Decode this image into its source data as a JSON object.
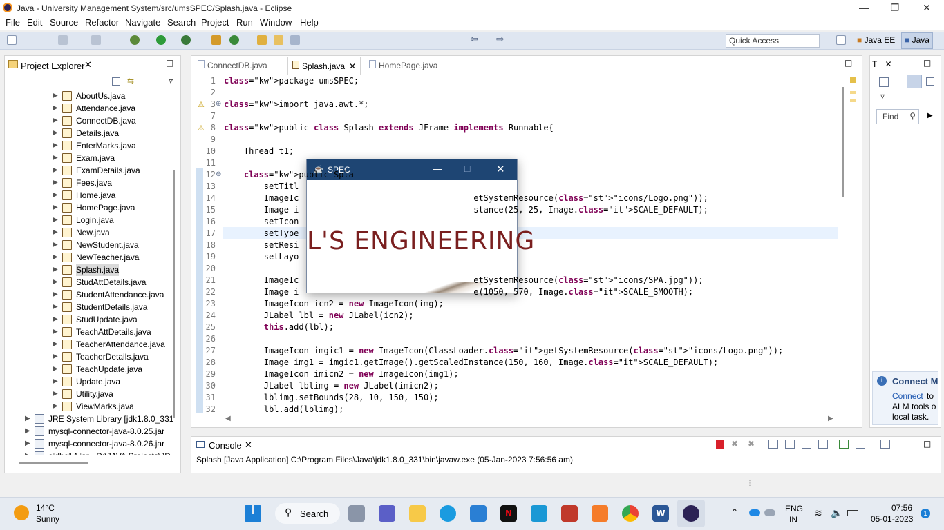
{
  "window": {
    "title": "Java - University Management System/src/umsSPEC/Splash.java - Eclipse"
  },
  "menu": [
    "File",
    "Edit",
    "Source",
    "Refactor",
    "Navigate",
    "Search",
    "Project",
    "Run",
    "Window",
    "Help"
  ],
  "toolbar": {
    "quick_access": "Quick Access",
    "persp_javaee": "Java EE",
    "persp_java": "Java"
  },
  "project_explorer": {
    "title": "Project Explorer",
    "files": [
      "AboutUs.java",
      "Attendance.java",
      "ConnectDB.java",
      "Details.java",
      "EnterMarks.java",
      "Exam.java",
      "ExamDetails.java",
      "Fees.java",
      "Home.java",
      "HomePage.java",
      "Login.java",
      "New.java",
      "NewStudent.java",
      "NewTeacher.java",
      "Splash.java",
      "StudAttDetails.java",
      "StudentAttendance.java",
      "StudentDetails.java",
      "StudUpdate.java",
      "TeachAttDetails.java",
      "TeacherAttendance.java",
      "TeacherDetails.java",
      "TeachUpdate.java",
      "Update.java",
      "Utility.java",
      "ViewMarks.java"
    ],
    "selected": "Splash.java",
    "libs": [
      "JRE System Library [jdk1.8.0_331]",
      "mysql-connector-java-8.0.25.jar",
      "mysql-connector-java-8.0.26.jar",
      "ojdbc14.jar - D:\\JAVA Projects\\JD"
    ]
  },
  "editor": {
    "tabs": [
      "ConnectDB.java",
      "Splash.java",
      "HomePage.java"
    ],
    "active_tab": "Splash.java",
    "lines": [
      {
        "n": "1",
        "t": "package umsSPEC;"
      },
      {
        "n": "2",
        "t": ""
      },
      {
        "n": "3",
        "t": "import java.awt.*;"
      },
      {
        "n": "7",
        "t": ""
      },
      {
        "n": "8",
        "t": "public class Splash extends JFrame implements Runnable{"
      },
      {
        "n": "9",
        "t": ""
      },
      {
        "n": "10",
        "t": "    Thread t1;"
      },
      {
        "n": "11",
        "t": ""
      },
      {
        "n": "12",
        "t": "    public Spla"
      },
      {
        "n": "13",
        "t": "        setTitl"
      },
      {
        "n": "14",
        "t": "        ImageIc                                   etSystemResource(\"icons/Logo.png\"));"
      },
      {
        "n": "15",
        "t": "        Image i                                   stance(25, 25, Image.SCALE_DEFAULT);"
      },
      {
        "n": "16",
        "t": "        setIcon"
      },
      {
        "n": "17",
        "t": "        setType"
      },
      {
        "n": "18",
        "t": "        setResi"
      },
      {
        "n": "19",
        "t": "        setLayo"
      },
      {
        "n": "20",
        "t": ""
      },
      {
        "n": "21",
        "t": "        ImageIc                                   etSystemResource(\"icons/SPA.jpg\"));"
      },
      {
        "n": "22",
        "t": "        Image i                                   e(1050, 570, Image.SCALE_SMOOTH);"
      },
      {
        "n": "23",
        "t": "        ImageIcon icn2 = new ImageIcon(img);"
      },
      {
        "n": "24",
        "t": "        JLabel lbl = new JLabel(icn2);"
      },
      {
        "n": "25",
        "t": "        this.add(lbl);"
      },
      {
        "n": "26",
        "t": ""
      },
      {
        "n": "27",
        "t": "        ImageIcon imgic1 = new ImageIcon(ClassLoader.getSystemResource(\"icons/Logo.png\"));"
      },
      {
        "n": "28",
        "t": "        Image img1 = imgic1.getImage().getScaledInstance(150, 160, Image.SCALE_DEFAULT);"
      },
      {
        "n": "29",
        "t": "        ImageIcon imicn2 = new ImageIcon(img1);"
      },
      {
        "n": "30",
        "t": "        JLabel lblimg = new JLabel(imicn2);"
      },
      {
        "n": "31",
        "t": "        lblimg.setBounds(28, 10, 150, 150);"
      },
      {
        "n": "32",
        "t": "        lbl.add(lblimg);"
      }
    ]
  },
  "right_panel": {
    "tab": "T",
    "find": "Find",
    "connect_title": "Connect M",
    "connect_link": "Connect",
    "connect_text1": "to",
    "connect_text2": "ALM tools o",
    "connect_text3": "local task."
  },
  "console": {
    "title": "Console",
    "status": "Splash [Java Application] C:\\Program Files\\Java\\jdk1.8.0_331\\bin\\javaw.exe (05-Jan-2023 7:56:56 am)"
  },
  "splash": {
    "title": "SPEC",
    "banner": "L'S ENGINEERING"
  },
  "taskbar": {
    "weather_temp": "14°C",
    "weather_desc": "Sunny",
    "search": "Search",
    "lang1": "ENG",
    "lang2": "IN",
    "time": "07:56",
    "date": "05-01-2023",
    "notif": "1"
  }
}
